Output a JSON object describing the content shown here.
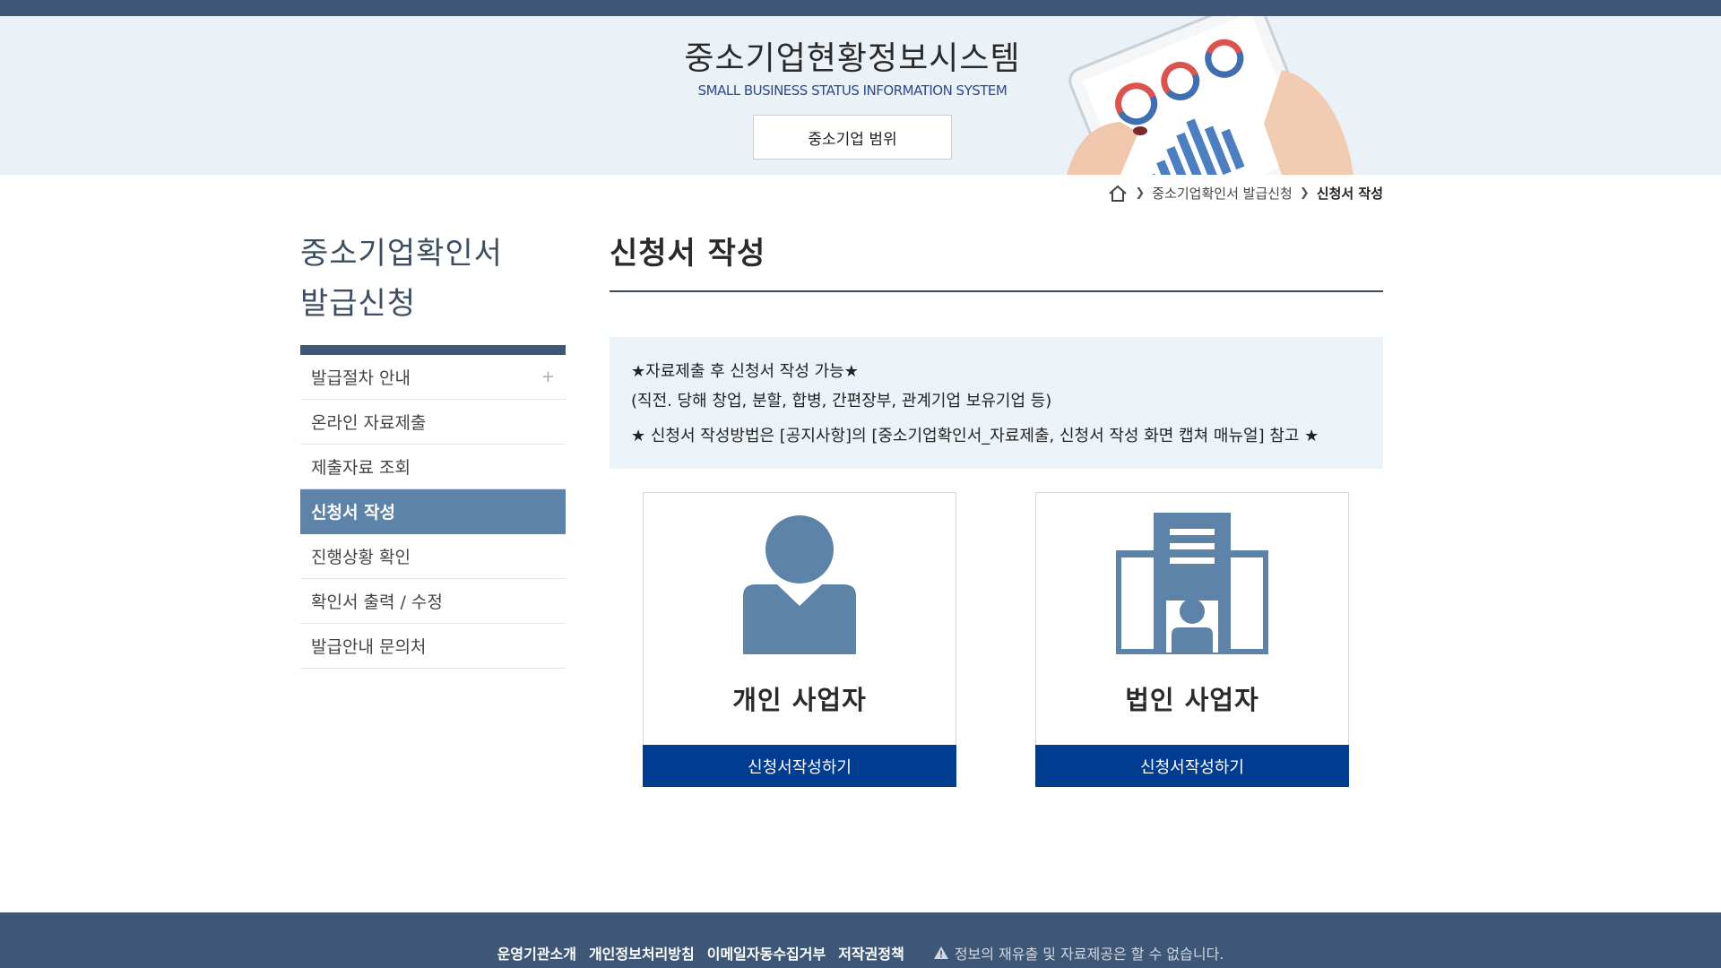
{
  "header": {
    "title": "중소기업현황정보시스템",
    "subtitle": "SMALL BUSINESS STATUS INFORMATION SYSTEM",
    "range_button": "중소기업 범위"
  },
  "breadcrumb": {
    "items": [
      "중소기업확인서 발급신청",
      "신청서 작성"
    ]
  },
  "sidebar": {
    "title_line1": "중소기업확인서",
    "title_line2": "발급신청",
    "items": [
      {
        "label": "발급절차 안내"
      },
      {
        "label": "온라인 자료제출"
      },
      {
        "label": "제출자료 조회"
      },
      {
        "label": "신청서 작성"
      },
      {
        "label": "진행상황 확인"
      },
      {
        "label": "확인서 출력 / 수정"
      },
      {
        "label": "발급안내 문의처"
      }
    ],
    "plus": "+"
  },
  "main": {
    "page_title": "신청서 작성",
    "notice": {
      "line1": "★자료제출 후 신청서 작성 가능★",
      "line2": "(직전. 당해 창업, 분할, 합병, 간편장부, 관계기업 보유기업 등)",
      "line3": "★ 신청서 작성방법은 [공지사항]의 [중소기업확인서_자료제출, 신청서 작성 화면 캡쳐 매뉴얼] 참고 ★"
    },
    "cards": [
      {
        "label": "개인 사업자",
        "button": "신청서작성하기"
      },
      {
        "label": "법인 사업자",
        "button": "신청서작성하기"
      }
    ]
  },
  "footer": {
    "links": [
      "운영기관소개",
      "개인정보처리방침",
      "이메일자동수집거부",
      "저작권정책"
    ],
    "warning": "정보의 재유출 및 자료제공은 할 수 없습니다."
  },
  "colors": {
    "navy": "#3e5776",
    "active": "#5d83a8",
    "button_blue": "#003c8f",
    "icon_blue": "#5d83a8",
    "banner_bg": "#eaf1f7"
  }
}
